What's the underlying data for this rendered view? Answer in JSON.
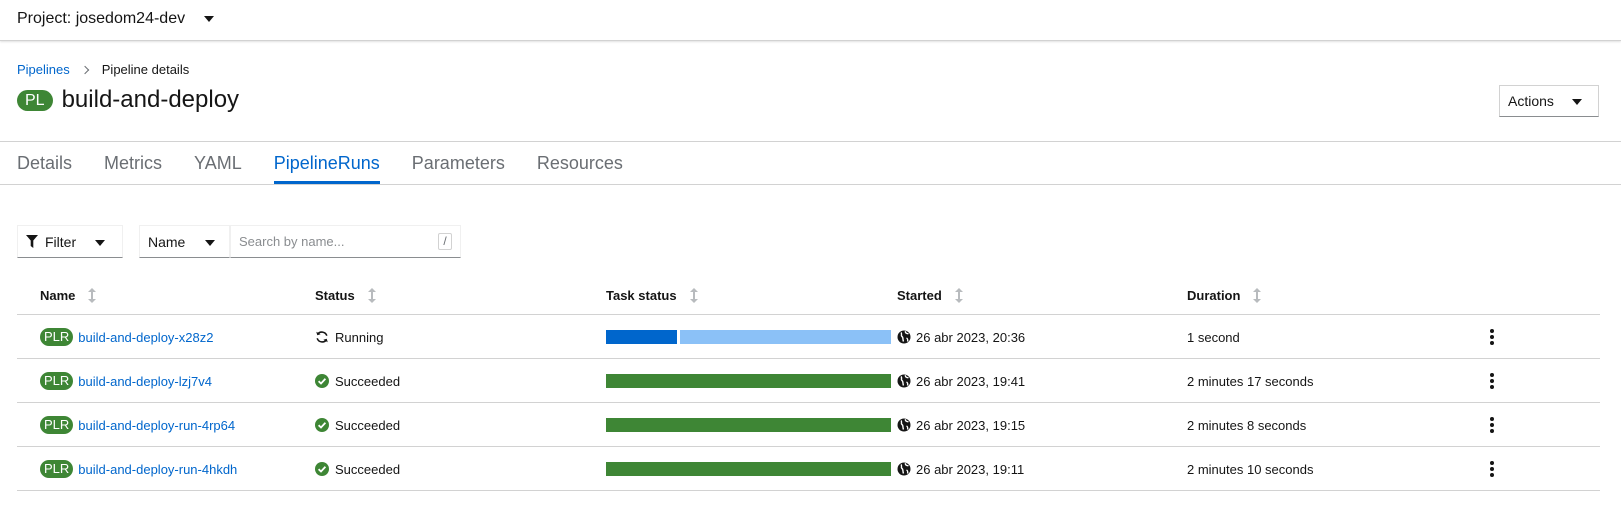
{
  "project": {
    "label": "Project: josedom24-dev"
  },
  "breadcrumb": {
    "parent": "Pipelines",
    "current": "Pipeline details"
  },
  "header": {
    "badge": "PL",
    "title": "build-and-deploy",
    "actions_label": "Actions"
  },
  "tabs": [
    {
      "label": "Details",
      "active": false
    },
    {
      "label": "Metrics",
      "active": false
    },
    {
      "label": "YAML",
      "active": false
    },
    {
      "label": "PipelineRuns",
      "active": true
    },
    {
      "label": "Parameters",
      "active": false
    },
    {
      "label": "Resources",
      "active": false
    }
  ],
  "toolbar": {
    "filter_label": "Filter",
    "attribute_label": "Name",
    "search_placeholder": "Search by name...",
    "search_value": "",
    "shortcut_key": "/"
  },
  "table": {
    "columns": [
      "Name",
      "Status",
      "Task status",
      "Started",
      "Duration"
    ],
    "rows": [
      {
        "badge": "PLR",
        "name": "build-and-deploy-x28z2",
        "status": "Running",
        "status_icon": "sync-icon",
        "task_progress": 0.25,
        "started": "26 abr 2023, 20:36",
        "duration": "1 second"
      },
      {
        "badge": "PLR",
        "name": "build-and-deploy-lzj7v4",
        "status": "Succeeded",
        "status_icon": "check-circle-icon",
        "task_progress": 1,
        "started": "26 abr 2023, 19:41",
        "duration": "2 minutes 17 seconds"
      },
      {
        "badge": "PLR",
        "name": "build-and-deploy-run-4rp64",
        "status": "Succeeded",
        "status_icon": "check-circle-icon",
        "task_progress": 1,
        "started": "26 abr 2023, 19:15",
        "duration": "2 minutes 8 seconds"
      },
      {
        "badge": "PLR",
        "name": "build-and-deploy-run-4hkdh",
        "status": "Succeeded",
        "status_icon": "check-circle-icon",
        "task_progress": 1,
        "started": "26 abr 2023, 19:11",
        "duration": "2 minutes 10 seconds"
      }
    ]
  },
  "colors": {
    "link": "#0066cc",
    "success": "#3e8635",
    "running_done": "#0066cc",
    "running_pending": "#8bc1f7"
  }
}
